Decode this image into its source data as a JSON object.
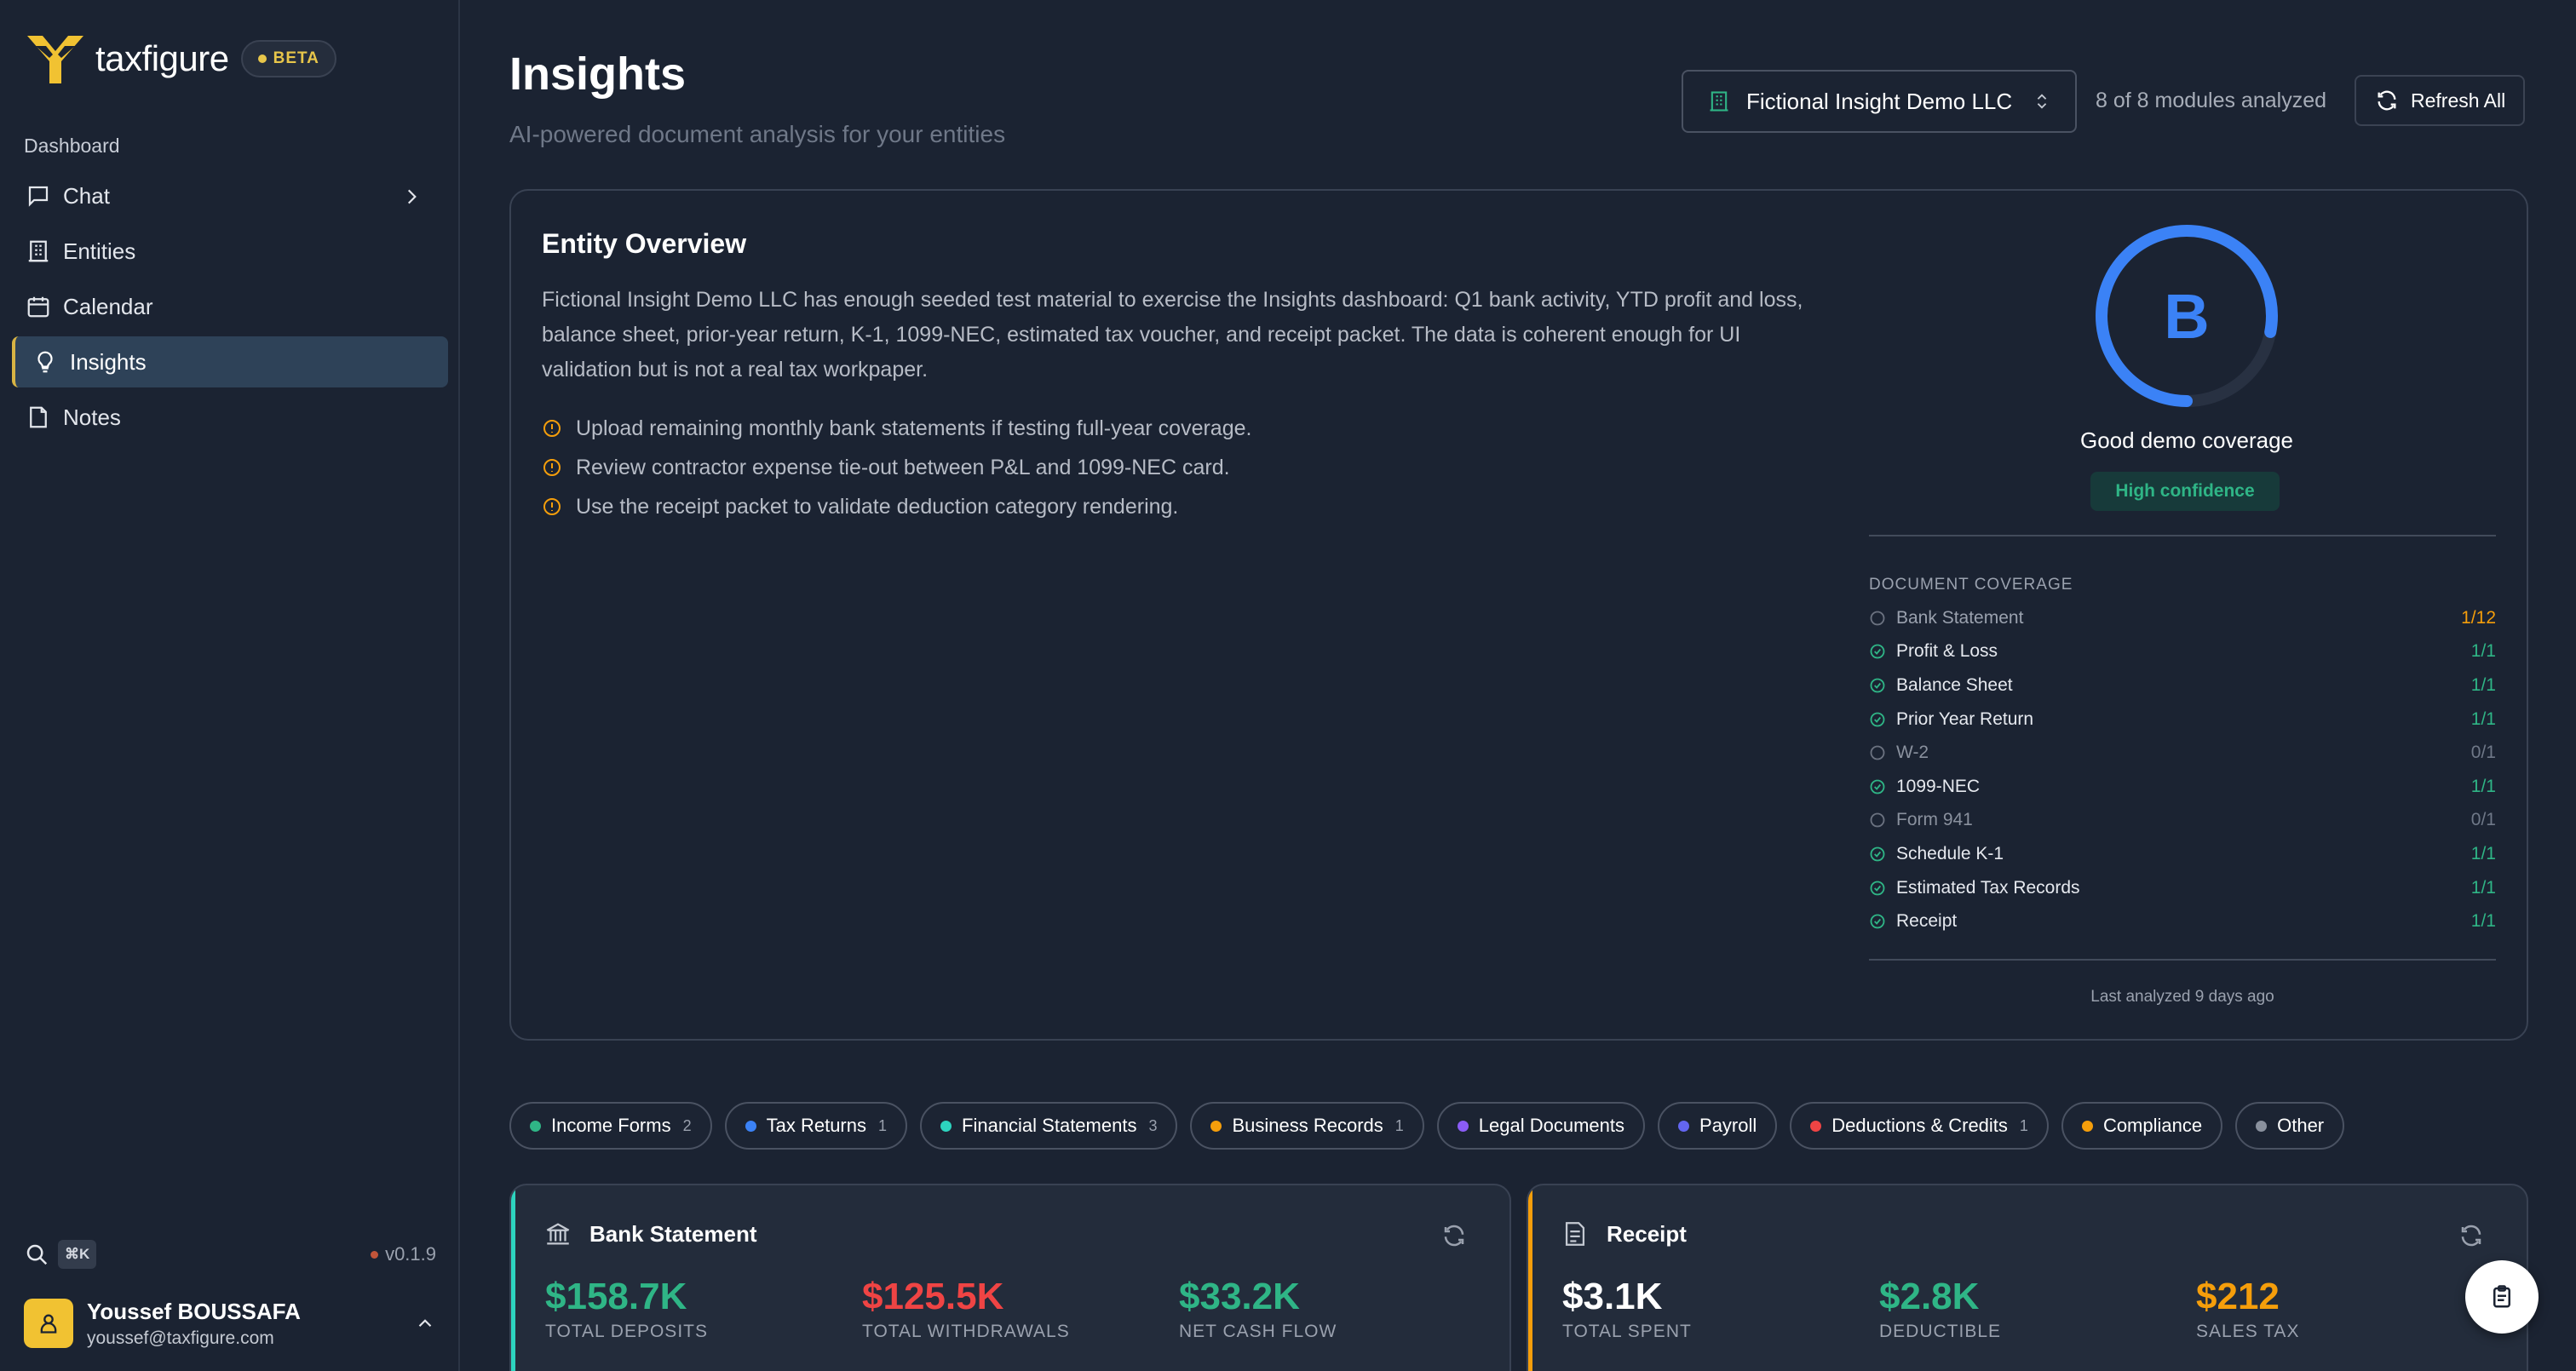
{
  "app": {
    "name": "taxfigure",
    "badge": "BETA",
    "version": "v0.1.9",
    "shortcut": "⌘K"
  },
  "sidebar": {
    "section_label": "Dashboard",
    "items": [
      {
        "label": "Chat",
        "icon": "chat-icon"
      },
      {
        "label": "Entities",
        "icon": "building-icon"
      },
      {
        "label": "Calendar",
        "icon": "calendar-icon"
      },
      {
        "label": "Insights",
        "icon": "lightbulb-icon",
        "active": true
      },
      {
        "label": "Notes",
        "icon": "note-icon"
      }
    ]
  },
  "user": {
    "name": "Youssef BOUSSAFA",
    "email": "youssef@taxfigure.com"
  },
  "header": {
    "title": "Insights",
    "subtitle": "AI-powered document analysis for your entities",
    "entity_select": "Fictional Insight Demo LLC",
    "modules_status": "8 of 8 modules analyzed",
    "refresh_label": "Refresh All"
  },
  "overview": {
    "title": "Entity Overview",
    "description": "Fictional Insight Demo LLC has enough seeded test material to exercise the Insights dashboard: Q1 bank activity, YTD profit and loss, balance sheet, prior-year return, K-1, 1099-NEC, estimated tax voucher, and receipt packet. The data is coherent enough for UI validation but is not a real tax workpaper.",
    "recommendations": [
      "Upload remaining monthly bank statements if testing full-year coverage.",
      "Review contractor expense tie-out between P&L and 1099-NEC card.",
      "Use the receipt packet to validate deduction category rendering."
    ],
    "grade": "B",
    "grade_progress": 0.78,
    "grade_label": "Good demo coverage",
    "confidence": "High confidence",
    "coverage_title": "DOCUMENT COVERAGE",
    "coverage": [
      {
        "name": "Bank Statement",
        "value": "1/12",
        "status": "partial"
      },
      {
        "name": "Profit & Loss",
        "value": "1/1",
        "status": "complete"
      },
      {
        "name": "Balance Sheet",
        "value": "1/1",
        "status": "complete"
      },
      {
        "name": "Prior Year Return",
        "value": "1/1",
        "status": "complete"
      },
      {
        "name": "W-2",
        "value": "0/1",
        "status": "missing"
      },
      {
        "name": "1099-NEC",
        "value": "1/1",
        "status": "complete"
      },
      {
        "name": "Form 941",
        "value": "0/1",
        "status": "missing"
      },
      {
        "name": "Schedule K-1",
        "value": "1/1",
        "status": "complete"
      },
      {
        "name": "Estimated Tax Records",
        "value": "1/1",
        "status": "complete"
      },
      {
        "name": "Receipt",
        "value": "1/1",
        "status": "complete"
      }
    ],
    "last_analyzed": "Last analyzed 9 days ago"
  },
  "categories": [
    {
      "label": "Income Forms",
      "count": "2",
      "color": "#2fb586"
    },
    {
      "label": "Tax Returns",
      "count": "1",
      "color": "#3b82f6"
    },
    {
      "label": "Financial Statements",
      "count": "3",
      "color": "#2dd4bf"
    },
    {
      "label": "Business Records",
      "count": "1",
      "color": "#f59e0b"
    },
    {
      "label": "Legal Documents",
      "count": "",
      "color": "#8b5cf6"
    },
    {
      "label": "Payroll",
      "count": "",
      "color": "#6366f1"
    },
    {
      "label": "Deductions & Credits",
      "count": "1",
      "color": "#ef4444"
    },
    {
      "label": "Compliance",
      "count": "",
      "color": "#f59e0b"
    },
    {
      "label": "Other",
      "count": "",
      "color": "#8a919e"
    }
  ],
  "cards": [
    {
      "title": "Bank Statement",
      "icon": "bank-icon",
      "accent": "#2dd4bf",
      "metrics": [
        {
          "value": "$158.7K",
          "label": "TOTAL DEPOSITS",
          "color": "#2fb586"
        },
        {
          "value": "$125.5K",
          "label": "TOTAL WITHDRAWALS",
          "color": "#ef4444"
        },
        {
          "value": "$33.2K",
          "label": "NET CASH FLOW",
          "color": "#2fb586"
        }
      ]
    },
    {
      "title": "Receipt",
      "icon": "receipt-icon",
      "accent": "#f59e0b",
      "metrics": [
        {
          "value": "$3.1K",
          "label": "TOTAL SPENT",
          "color": "#ffffff"
        },
        {
          "value": "$2.8K",
          "label": "DEDUCTIBLE",
          "color": "#2fb586"
        },
        {
          "value": "$212",
          "label": "SALES TAX",
          "color": "#f59e0b"
        }
      ]
    }
  ],
  "colors": {
    "background": "#1b2332",
    "accent_blue": "#3b82f6",
    "success": "#2fb586",
    "warning": "#f59e0b",
    "danger": "#ef4444"
  }
}
